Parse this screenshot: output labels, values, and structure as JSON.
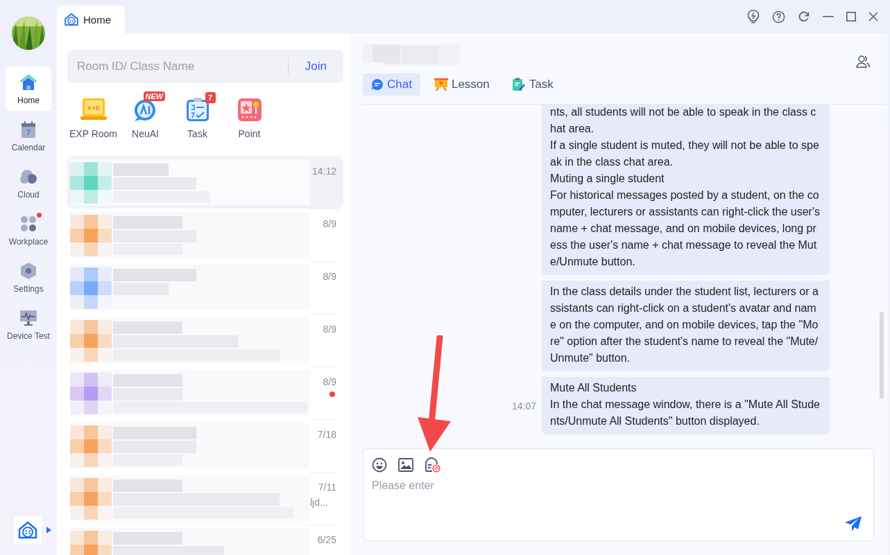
{
  "home_tab": {
    "label": "Home",
    "selected": true
  },
  "sidebar": {
    "items": [
      {
        "label": "Home",
        "kind": "home",
        "selected": true,
        "badge": false
      },
      {
        "label": "Calendar",
        "kind": "calendar",
        "selected": false,
        "badge": false,
        "day": "7"
      },
      {
        "label": "Cloud",
        "kind": "cloud",
        "selected": false,
        "badge": false
      },
      {
        "label": "Workplace",
        "kind": "workplace",
        "selected": false,
        "badge": true
      },
      {
        "label": "Settings",
        "kind": "settings",
        "selected": false,
        "badge": false
      },
      {
        "label": "Device Test",
        "kind": "device",
        "selected": false,
        "badge": false
      }
    ]
  },
  "search": {
    "placeholder": "Room ID/ Class Name",
    "button": "Join"
  },
  "shortcuts": [
    {
      "label": "EXP Room",
      "kind": "exp",
      "icon_text": "A+B"
    },
    {
      "label": "NeuAI",
      "kind": "ai",
      "tag": "NEW"
    },
    {
      "label": "Task",
      "kind": "task",
      "count": "7"
    },
    {
      "label": "Point",
      "kind": "point"
    }
  ],
  "chats": [
    {
      "time": "14:12",
      "selected": true,
      "unread": false,
      "color": "#5fd6c0"
    },
    {
      "time": "8/9",
      "selected": false,
      "unread": false,
      "color": "#f7a35c"
    },
    {
      "time": "8/9",
      "selected": false,
      "unread": false,
      "color": "#7aa8fb"
    },
    {
      "time": "8/9",
      "selected": false,
      "unread": false,
      "color": "#f7a35c"
    },
    {
      "time": "8/9",
      "selected": false,
      "unread": true,
      "color": "#b89cf0"
    },
    {
      "time": "7/18",
      "selected": false,
      "unread": false,
      "color": "#f7a35c"
    },
    {
      "time": "7/11",
      "selected": false,
      "unread": false,
      "color": "#f7a35c",
      "preview": "ljd..."
    },
    {
      "time": "6/25",
      "selected": false,
      "unread": false,
      "color": "#f7a35c"
    }
  ],
  "class_tabs": [
    {
      "label": "Chat",
      "kind": "chat",
      "selected": true
    },
    {
      "label": "Lesson",
      "kind": "lesson",
      "selected": false
    },
    {
      "label": "Task",
      "kind": "task",
      "selected": false
    }
  ],
  "messages": [
    {
      "paragraphs": [
        "nts, all students will not be able to speak in the class chat area.",
        "If a single student is muted, they will not be able to speak in the class chat area.",
        "Muting a single student",
        "For historical messages posted by a student, on the computer, lecturers or assistants can right-click the user's name + chat message, and on mobile devices, long press the user's name + chat message to reveal the Mute/Unmute button."
      ]
    },
    {
      "paragraphs": [
        "In the class details under the student list, lecturers or assistants can right-click on a student's avatar and name on the computer, and on mobile devices, tap the \"More\" option after the student's name to reveal the \"Mute/Unmute\" button."
      ]
    },
    {
      "time": "14:07",
      "paragraphs": [
        "Mute All Students",
        "In the chat message window, there is a \"Mute All Students/Unmute All Students\" button displayed."
      ]
    }
  ],
  "composer": {
    "placeholder": "Please enter"
  }
}
